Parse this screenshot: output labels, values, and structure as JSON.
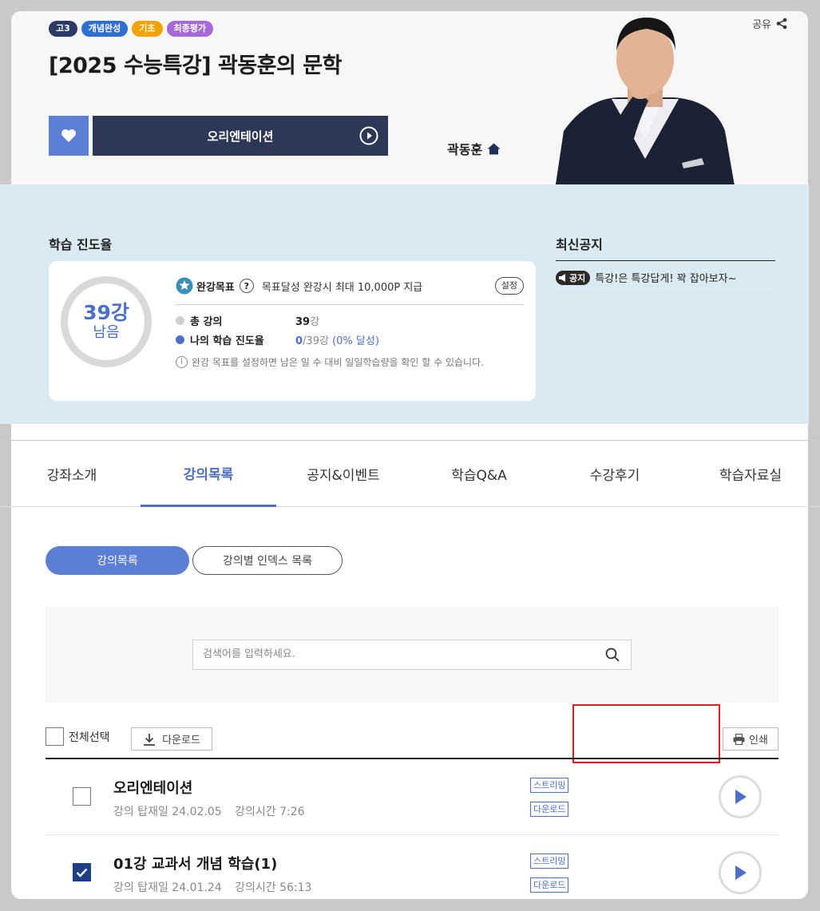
{
  "header": {
    "badges": [
      "고3",
      "개념완성",
      "기초",
      "최종평가"
    ],
    "title": "[2025 수능특강] 곽동훈의 문학",
    "share_label": "공유",
    "orientation_button": "오리엔테이션",
    "teacher_name": "곽동훈"
  },
  "progress": {
    "section_title": "학습 진도율",
    "remaining_number": "39강",
    "remaining_label": "남음",
    "goal_label": "완강목표",
    "goal_help": "?",
    "goal_desc": "목표달성 완강시 최대 10,000P 지급",
    "setting_button": "설정",
    "total_label": "총 강의",
    "total_value": "39",
    "total_unit": "강",
    "my_label": "나의 학습 진도율",
    "my_done": "0",
    "my_total": "/39강",
    "my_percent": "(0% 달성)",
    "info_text": "완강 목표를 설정하면 남은 일 수 대비 일일학습량을 확인 할 수 있습니다."
  },
  "notice": {
    "title": "최신공지",
    "tag": "공지",
    "item": "특강!은 특강답게! 꽉 잡아보자~"
  },
  "tabs": [
    "강좌소개",
    "강의목록",
    "공지&이벤트",
    "학습Q&A",
    "수강후기",
    "학습자료실"
  ],
  "active_tab": "강의목록",
  "list_modes": [
    "강의목록",
    "강의별 인덱스 목록"
  ],
  "search": {
    "placeholder": "검색어를 입력하세요."
  },
  "toolbar": {
    "select_all": "전체선택",
    "download": "다운로드",
    "print": "인쇄"
  },
  "lectures": [
    {
      "title": "오리엔테이션",
      "date_label": "강의 탑재일 24.02.05",
      "time_label": "강의시간 7:26",
      "stream": "스트리밍",
      "download": "다운로드",
      "checked": false
    },
    {
      "title": "01강 교과서 개념 학습(1)",
      "date_label": "강의 탑재일 24.01.24",
      "time_label": "강의시간 56:13",
      "stream": "스트리밍",
      "download": "다운로드",
      "checked": true
    }
  ],
  "colors": {
    "accent": "#4c70c6",
    "navy": "#2d3856",
    "band": "#d9eaf3",
    "highlight": "#e01e1e"
  }
}
